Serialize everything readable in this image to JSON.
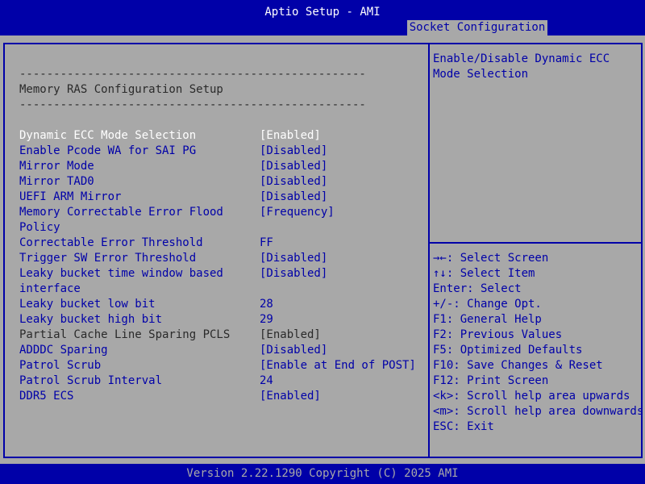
{
  "header": {
    "title": "Aptio Setup - AMI",
    "active_tab": "Socket Configuration"
  },
  "main": {
    "separator": "---------------------------------------------------",
    "section_title": "Memory RAS Configuration Setup",
    "items": [
      {
        "label": "Dynamic ECC Mode Selection",
        "value": "[Enabled]"
      },
      {
        "label": "Enable Pcode WA for SAI PG",
        "value": "[Disabled]"
      },
      {
        "label": "Mirror Mode",
        "value": "[Disabled]"
      },
      {
        "label": "Mirror TAD0",
        "value": "[Disabled]"
      },
      {
        "label": "UEFI ARM Mirror",
        "value": "[Disabled]"
      },
      {
        "label": "Memory Correctable Error Flood",
        "label2": "Policy",
        "value": "[Frequency]"
      },
      {
        "label": "Correctable Error Threshold",
        "value": "FF"
      },
      {
        "label": "Trigger SW Error Threshold",
        "value": "[Disabled]"
      },
      {
        "label": "Leaky bucket time window based",
        "label2": "interface",
        "value": "[Disabled]"
      },
      {
        "label": "Leaky bucket low bit",
        "value": "28"
      },
      {
        "label": "Leaky bucket high bit",
        "value": "29"
      },
      {
        "label": "Partial Cache Line Sparing PCLS",
        "value": "[Enabled]"
      },
      {
        "label": "ADDDC Sparing",
        "value": "[Disabled]"
      },
      {
        "label": "Patrol Scrub",
        "value": "[Enable at End of POST]"
      },
      {
        "label": "Patrol Scrub Interval",
        "value": "24"
      },
      {
        "label": "DDR5 ECS",
        "value": "[Enabled]"
      }
    ]
  },
  "help": {
    "line1": "Enable/Disable Dynamic ECC",
    "line2": "Mode Selection"
  },
  "keys": [
    "→←: Select Screen",
    "↑↓: Select Item",
    "Enter: Select",
    "+/-: Change Opt.",
    "F1: General Help",
    "F2: Previous Values",
    "F5: Optimized Defaults",
    "F10: Save Changes & Reset",
    "F12: Print Screen",
    "<k>: Scroll help area upwards",
    "<m>: Scroll help area downwards",
    "ESC: Exit"
  ],
  "footer": {
    "version": "Version 2.22.1290 Copyright (C) 2025 AMI"
  },
  "colors": {
    "bar": "#0000a8",
    "panel": "#a8a8a8",
    "selected": "#ffffff"
  }
}
